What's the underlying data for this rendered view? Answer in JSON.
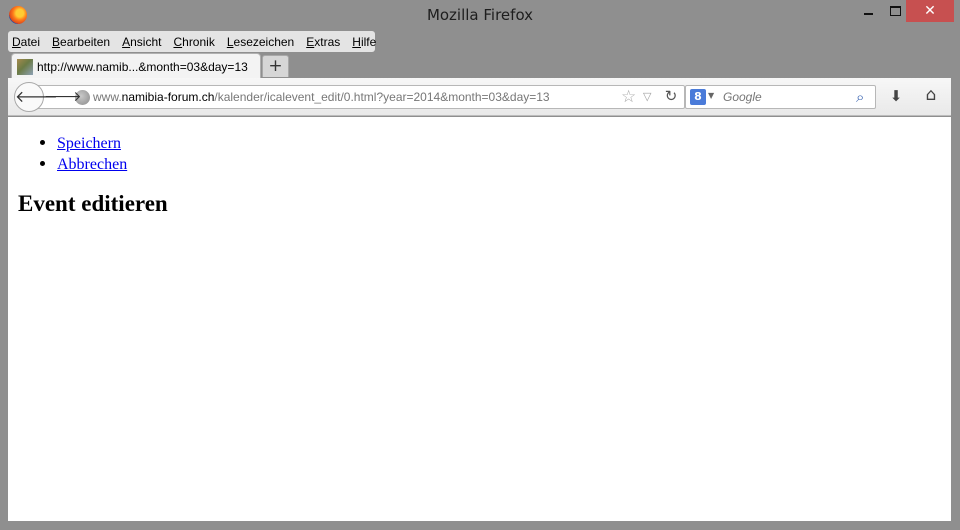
{
  "window": {
    "title": "Mozilla Firefox",
    "close_glyph": "✕"
  },
  "menubar": {
    "items": [
      {
        "mnemonic": "D",
        "rest": "atei"
      },
      {
        "mnemonic": "B",
        "rest": "earbeiten"
      },
      {
        "mnemonic": "A",
        "rest": "nsicht"
      },
      {
        "mnemonic": "C",
        "rest": "hronik"
      },
      {
        "mnemonic": "L",
        "rest": "esezeichen"
      },
      {
        "mnemonic": "E",
        "rest": "xtras"
      },
      {
        "mnemonic": "H",
        "rest": "ilfe"
      }
    ]
  },
  "tab": {
    "title": "http://www.namib...&month=03&day=13",
    "new_tab_label": "+"
  },
  "navbar": {
    "url_prefix": "www.",
    "url_domain": "namibia-forum.ch",
    "url_path": "/kalender/icalevent_edit/0.html?year=2014&month=03&day=13",
    "search_placeholder": "Google",
    "search_engine_badge": "8"
  },
  "page": {
    "links": [
      "Speichern",
      "Abbrechen"
    ],
    "heading": "Event editieren"
  },
  "icons": {
    "back": "arrow-left-icon",
    "forward": "arrow-right-icon",
    "reload": "reload-icon",
    "star": "bookmark-star-icon",
    "download": "download-icon",
    "home": "home-icon",
    "search": "magnifier-icon"
  },
  "colors": {
    "close_button": "#c75050",
    "link": "#0000ee",
    "chrome_bg": "#8f8f8f"
  }
}
